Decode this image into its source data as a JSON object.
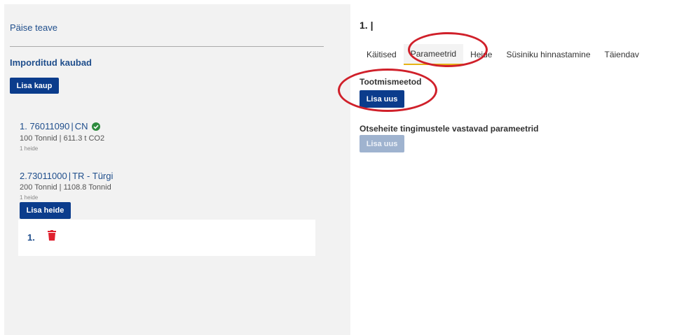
{
  "left": {
    "header_info": "Päise teave",
    "section_title": "Imporditud kaubad",
    "add_goods_label": "Lisa kaup",
    "goods": [
      {
        "code": "1. 76011090",
        "origin": "CN",
        "quantity_line": "100 Tonnid | 611.3 t CO2",
        "emission_count": "1 heide",
        "status_icon": "check-circle-icon"
      },
      {
        "code": "2.73011000",
        "origin": "TR - Türgi",
        "quantity_line": "200 Tonnid | 1108.8 Tonnid",
        "emission_count": "1 heide",
        "add_emission_label": "Lisa heide"
      }
    ],
    "emission_item": {
      "number": "1.",
      "delete_icon": "trash-icon"
    }
  },
  "right": {
    "title": "1. |",
    "tabs": [
      "Käitised",
      "Parameetrid",
      "Heide",
      "Süsiniku hinnastamine",
      "Täiendav"
    ],
    "active_tab": "Parameetrid",
    "production_methods_label": "Tootmismeetod",
    "add_new_label": "Lisa uus",
    "direct_params_label": "Otseheite tingimustele vastavad parameetrid",
    "add_new_disabled_label": "Lisa uus"
  },
  "colors": {
    "primary_button": "#0b3c8c",
    "disabled_button": "#9fb3cf",
    "link_blue": "#1f4e8c",
    "annotation_red": "#d0202a",
    "active_tab_underline": "#e7b416",
    "check_green": "#2e8b3e",
    "trash_red": "#e0202e"
  }
}
